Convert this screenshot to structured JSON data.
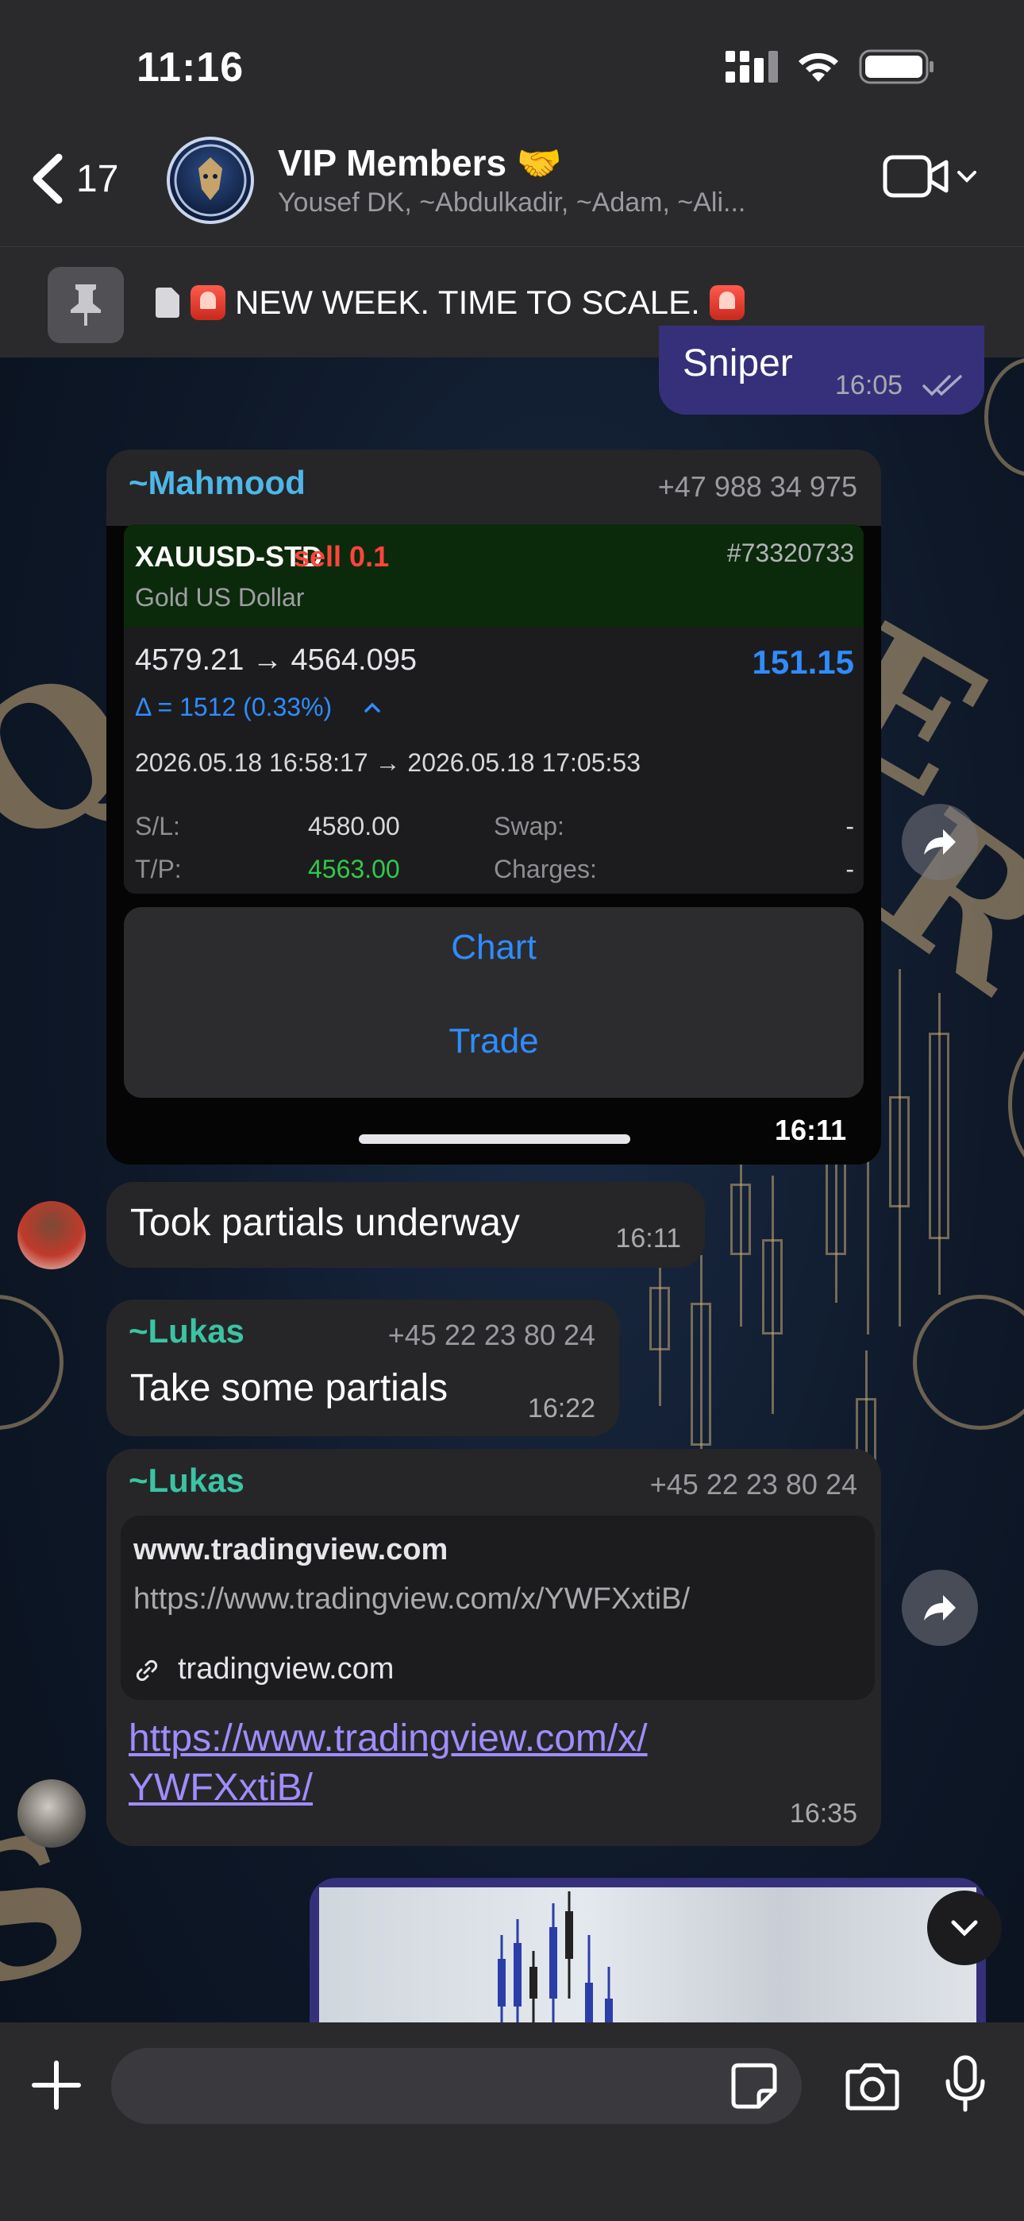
{
  "status_bar": {
    "time": "11:16"
  },
  "header": {
    "back_count": "17",
    "title": "VIP Members 🤝",
    "members": "Yousef DK, ~Abdulkadir, ~Adam, ~Ali...",
    "avatar_text": "LIQUIDITY HUNTERS VIP MEMBER"
  },
  "pinned": {
    "text": "NEW WEEK. TIME TO SCALE."
  },
  "messages": {
    "outgoing": {
      "text": "Sniper",
      "time": "16:05"
    },
    "trade": {
      "sender": "~Mahmood",
      "phone": "+47 988 34 975",
      "symbol": "XAUUSD-STD",
      "side": "sell 0.1",
      "order_id": "#73320733",
      "instrument": "Gold US Dollar",
      "prices": "4579.21 → 4564.095",
      "profit": "151.15",
      "delta": "Δ = 1512 (0.33%)",
      "dates": "2026.05.18 16:58:17 → 2026.05.18 17:05:53",
      "sl_label": "S/L:",
      "sl_value": "4580.00",
      "tp_label": "T/P:",
      "tp_value": "4563.00",
      "swap_label": "Swap:",
      "swap_value": "-",
      "charges_label": "Charges:",
      "charges_value": "-",
      "chart_button": "Chart",
      "trade_button": "Trade",
      "time": "16:11"
    },
    "partials_1": {
      "text": "Took partials underway",
      "time": "16:11"
    },
    "partials_2": {
      "sender": "~Lukas",
      "phone": "+45 22 23 80 24",
      "text": "Take some partials",
      "time": "16:22"
    },
    "link_msg": {
      "sender": "~Lukas",
      "phone": "+45 22 23 80 24",
      "preview_site": "www.tradingview.com",
      "preview_url": "https://www.tradingview.com/x/YWFXxtiB/",
      "preview_domain": "tradingview.com",
      "link_line1": "https://www.tradingview.com/x/",
      "link_line2": "YWFXxtiB/",
      "time": "16:35"
    }
  },
  "colors": {
    "accent_blue": "#2f8cff",
    "sender_mahmood": "#4fb6e8",
    "sender_lukas": "#3bc4a4",
    "sell_red": "#ff453a",
    "tp_green": "#30c94a",
    "link_purple": "#a08cff"
  }
}
